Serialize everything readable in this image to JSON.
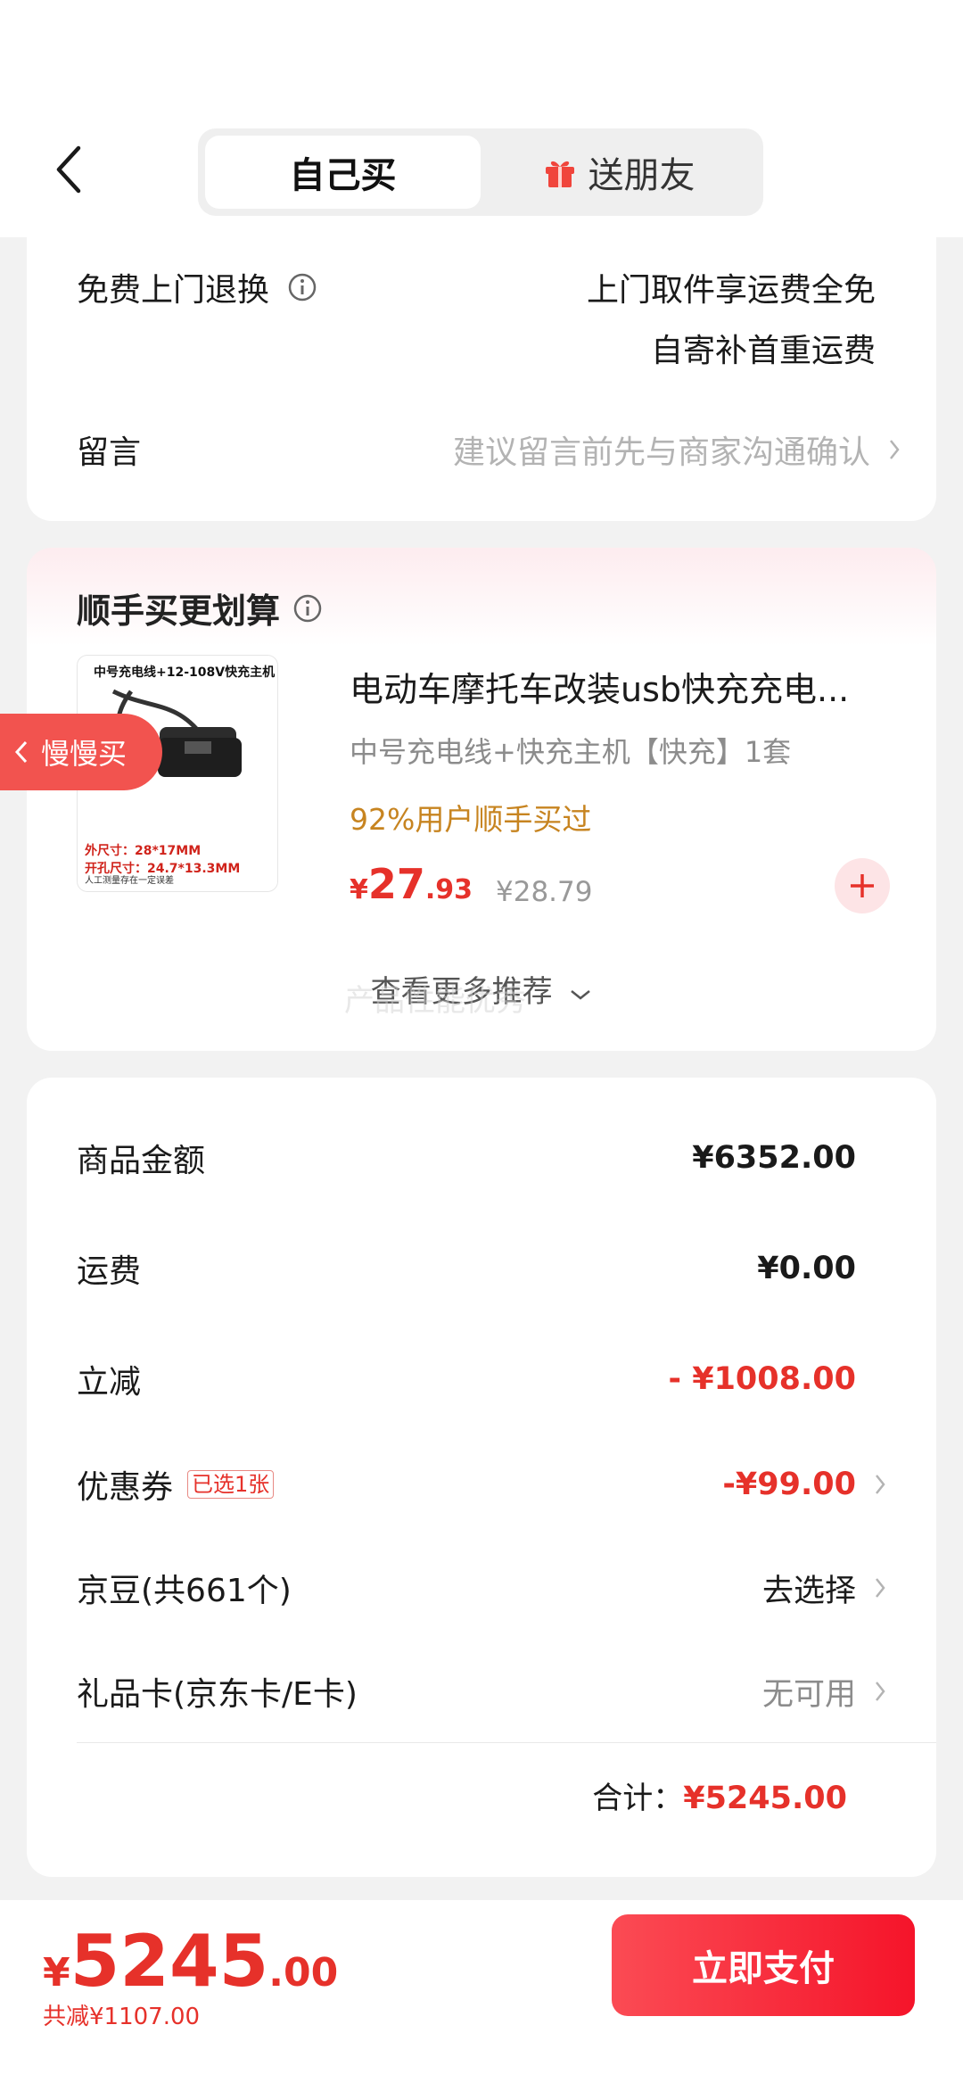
{
  "header": {
    "tabs": [
      {
        "label": "自己买",
        "active": true
      },
      {
        "label": "送朋友",
        "active": false,
        "icon": "gift-icon"
      }
    ]
  },
  "delivery": {
    "return_label": "免费上门退换",
    "return_line1": "上门取件享运费全免",
    "return_line2": "自寄补首重运费",
    "message_label": "留言",
    "message_placeholder": "建议留言前先与商家沟通确认"
  },
  "recommend": {
    "title": "顺手买更划算",
    "thumb_caption": "中号充电线+12-108V快充主机",
    "thumb_spec1": "外尺寸：28*17MM",
    "thumb_spec2": "开孔尺寸：24.7*13.3MM",
    "thumb_note": "人工测量存在一定误差",
    "slow_buy_label": "慢慢买",
    "product_title": "电动车摩托车改装usb快充充电...",
    "product_sku": "中号充电线+快充主机【快充】1套",
    "product_social": "92%用户顺手买过",
    "price_symbol": "¥",
    "price_int": "27",
    "price_dec": ".93",
    "original_price": "¥28.79",
    "more_label": "查看更多推荐",
    "watermark": "产品性能优秀"
  },
  "summary": {
    "rows": [
      {
        "label": "商品金额",
        "value": "¥6352.00"
      },
      {
        "label": "运费",
        "value": "¥0.00"
      },
      {
        "label": "立减",
        "value": "- ¥1008.00"
      },
      {
        "label": "优惠券",
        "badge": "已选1张",
        "value": "-¥99.00"
      },
      {
        "label": "京豆(共661个)",
        "value": "去选择"
      },
      {
        "label": "礼品卡(京东卡/E卡)",
        "value": "无可用"
      }
    ],
    "total_label": "合计：",
    "total_value": "¥5245.00"
  },
  "footer": {
    "price_symbol": "¥",
    "price_int": "5245",
    "price_dec": ".00",
    "saving": "共减¥1107.00",
    "pay_label": "立即支付"
  },
  "colors": {
    "accent_red": "#e6312a",
    "pay_button": "#f5142a",
    "social_orange": "#c78420"
  }
}
